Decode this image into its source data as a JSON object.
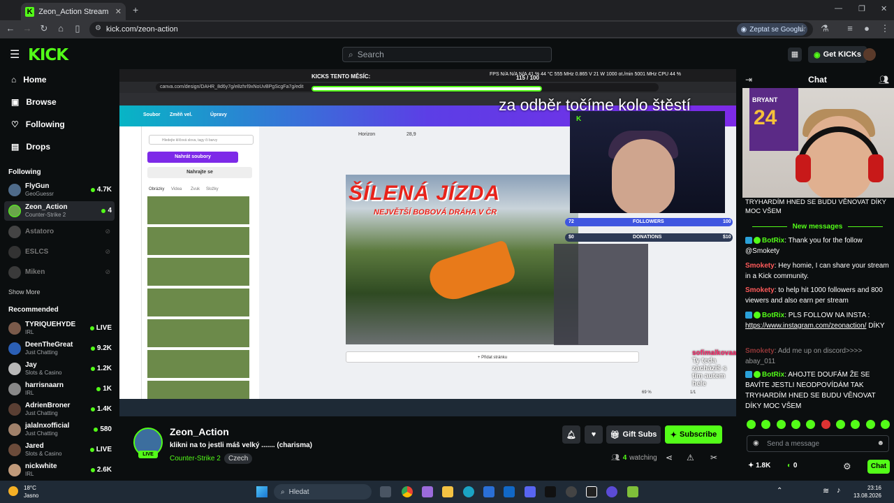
{
  "browser": {
    "tab_title": "Zeon_Action Stream - Watch Li",
    "url": "kick.com/zeon-action",
    "google_btn": "Zeptat se Googlu"
  },
  "header": {
    "logo": "KICK",
    "search_placeholder": "Search",
    "get_kicks": "Get KICKs"
  },
  "sidebar": {
    "nav": [
      "Home",
      "Browse",
      "Following",
      "Drops"
    ],
    "following_title": "Following",
    "following": [
      {
        "name": "FlyGun",
        "game": "GeoGuessr",
        "count": "4.7K",
        "live": true
      },
      {
        "name": "Zeon_Action",
        "game": "Counter-Strike 2",
        "count": "4",
        "live": true
      },
      {
        "name": "Astatoro",
        "game": "",
        "count": "",
        "live": false
      },
      {
        "name": "ESLCS",
        "game": "",
        "count": "",
        "live": false
      },
      {
        "name": "Miken",
        "game": "",
        "count": "",
        "live": false
      }
    ],
    "show_more": "Show More",
    "recommended_title": "Recommended",
    "recommended": [
      {
        "name": "TYRIQUEHYDE",
        "game": "IRL",
        "count": "LIVE"
      },
      {
        "name": "DeenTheGreat",
        "game": "Just Chatting",
        "count": "9.2K"
      },
      {
        "name": "Jay",
        "game": "Slots & Casino",
        "count": "1.2K"
      },
      {
        "name": "harrisnaarn",
        "game": "IRL",
        "count": "1K"
      },
      {
        "name": "AdrienBroner",
        "game": "Just Chatting",
        "count": "1.4K"
      },
      {
        "name": "jalalnxofficial",
        "game": "Just Chatting",
        "count": "580"
      },
      {
        "name": "Jared",
        "game": "Slots & Casino",
        "count": "LIVE"
      },
      {
        "name": "nickwhite",
        "game": "IRL",
        "count": "2.6K"
      }
    ]
  },
  "stream_overlay": {
    "kicks_month": "KICKS TENTO MĚSÍC:",
    "kicks_value": "115 / 100",
    "stats_line": "FPS N/A  N/A  N/A  41 % 44 °C 555 MHz 0.865 V 21 W 1000 ot./min 5001 MHz  CPU 44 %",
    "headline": "za odběr točíme kolo štěstí",
    "photo_title": "ŠÍLENÁ JÍZDA",
    "photo_sub": "NEJVĚTŠÍ BOBOVÁ DRÁHA V ČR",
    "followers_label": "FOLLOWERS",
    "followers_value": "72",
    "followers_goal": "100",
    "donations_label": "DONATIONS",
    "donations_value": "$0",
    "donations_goal": "$10",
    "follow_user": "sofimalkovaa",
    "follow_text": ": Ty teda zacházíš s tím autem hele",
    "canva_url": "canva.com/design/DAHR_8d6y7g/e8zhrl9xNoUvBPgScgFa7g/edit",
    "add_page": "+ Přidat stránku",
    "upload_btn": "Nahrát soubory",
    "record_btn": "Nahrajte se",
    "search_canva": "Hledejte klíčová slova, tagy či barvy",
    "canva_menu": [
      "Soubor",
      "Změň vel.",
      "Úpravy"
    ],
    "canva_font": "Horizon",
    "canva_size": "28,9",
    "canva_tabs": [
      "Obrázky",
      "Videa",
      "Zvuk",
      "Složky"
    ],
    "zoom": "69 %",
    "pages": "1/1"
  },
  "streamer": {
    "name": "Zeon_Action",
    "title": "klikni na to jestli máš velký ....... (charisma)",
    "game": "Counter-Strike 2",
    "language": "Czech",
    "live": "LIVE",
    "gift_subs": "Gift Subs",
    "subscribe": "Subscribe",
    "watching_count": "4",
    "watching_label": "watching"
  },
  "chat": {
    "title": "Chat",
    "pinned": "TRYHARDÍM HNED SE BUDU VĚNOVAT DÍKY MOC VŠEM",
    "new_messages": "New messages",
    "messages": [
      {
        "user": "BotRix",
        "type": "bot",
        "text": ": Thank you for the follow @Smokety"
      },
      {
        "user": "Smokety",
        "type": "user",
        "text": ": Hey homie, I can share your stream in a Kick community."
      },
      {
        "user": "Smokety",
        "type": "user",
        "text": ": to help hit 1000 followers and 800 viewers and also earn per stream"
      },
      {
        "user": "BotRix",
        "type": "bot",
        "text": ": PLS FOLLOW NA INSTA :",
        "link": "https://www.instagram.com/zeonaction/",
        "after": " DÍKY"
      },
      {
        "user": "Smokety",
        "type": "user",
        "text": ": Add me up on discord>>>> abay_011"
      },
      {
        "user": "BotRix",
        "type": "bot",
        "text": ": AHOJTE DOUFÁM ŽE SE BAVÍTE JESTLI NEODPOVÍDÁM TAK TRYHARDÍM HNED SE BUDU VĚNOVAT DÍKY MOC VŠEM"
      }
    ],
    "send_placeholder": "Send a message",
    "kicks_count": "1.8K",
    "points": "0",
    "chat_button": "Chat"
  },
  "taskbar": {
    "temp": "18°C",
    "weather": "Jasno",
    "search": "Hledat",
    "time": "23:16",
    "date": "13.08.2026"
  }
}
